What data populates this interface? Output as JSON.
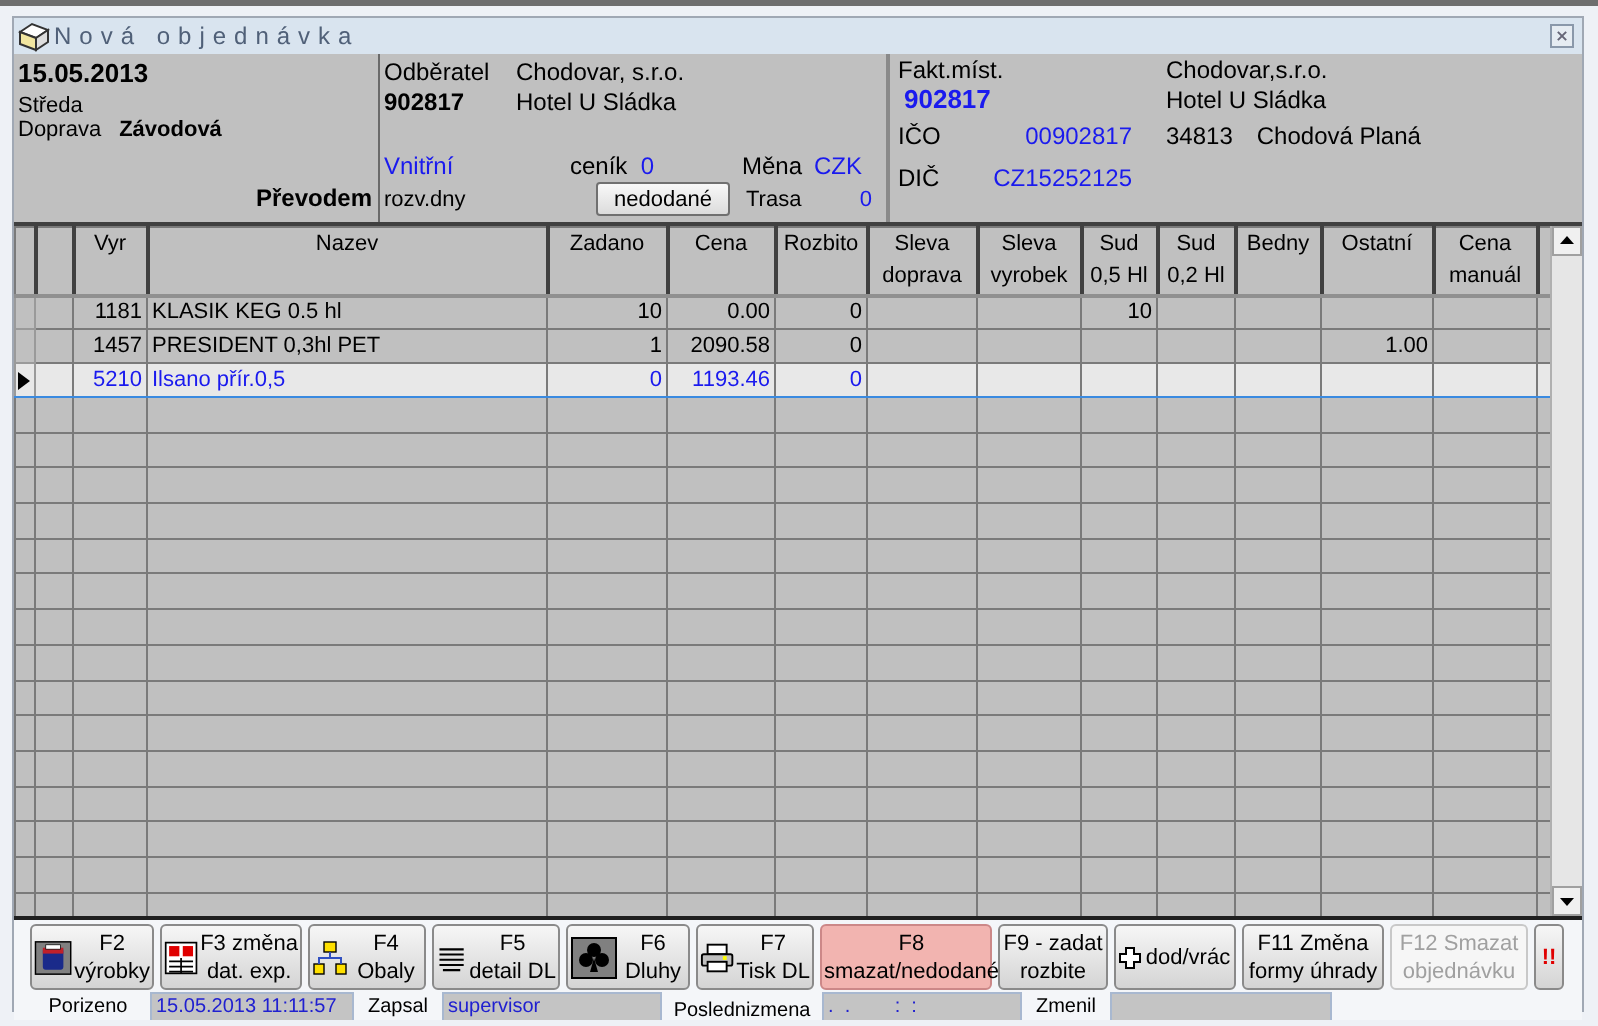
{
  "window": {
    "title": "Nová objednávka"
  },
  "header": {
    "date": "15.05.2013",
    "weekday": "Středa",
    "transport_label": "Doprava",
    "transport": "Závodová",
    "payment": "Převodem",
    "customer_label": "Odběratel",
    "customer_id": "902817",
    "customer_name": "Chodovar, s.r.o.",
    "customer_place": "Hotel U Sládka",
    "zone": "Vnitřní",
    "pricelist_label": "ceník",
    "pricelist": "0",
    "currency_label": "Měna",
    "currency": "CZK",
    "delivery_days_label": "rozv.dny",
    "undelivered_button": "nedodané",
    "route_label": "Trasa",
    "route": "0",
    "billing_label": "Fakt.míst.",
    "billing_id": "902817",
    "billing_name": "Chodovar,s.r.o.",
    "billing_place": "Hotel U Sládka",
    "ico_label": "IČO",
    "ico": "00902817",
    "dic_label": "DIČ",
    "dic": "CZ15252125",
    "zip": "34813",
    "city": "Chodová Planá"
  },
  "table": {
    "columns": [
      "Vyr",
      "Nazev",
      "Zadano",
      "Cena",
      "Rozbito",
      "Sleva doprava",
      "Sleva vyrobek",
      "Sud 0,5 Hl",
      "Sud 0,2 Hl",
      "Bedny",
      "Ostatní",
      "Cena manuál"
    ],
    "rows": [
      {
        "vyr": "1181",
        "nazev": "KLASIK KEG 0.5 hl",
        "zadano": "10",
        "cena": "0.00",
        "rozbito": "0",
        "sud_05": "10",
        "selected": false
      },
      {
        "vyr": "1457",
        "nazev": "PRESIDENT 0,3hl PET",
        "zadano": "1",
        "cena": "2090.58",
        "rozbito": "0",
        "ostatni": "1.00",
        "selected": false
      },
      {
        "vyr": "5210",
        "nazev": "Ilsano přír.0,5",
        "zadano": "0",
        "cena": "1193.46",
        "rozbito": "0",
        "selected": true
      }
    ]
  },
  "buttons": [
    {
      "lines": [
        "F2",
        "výrobky"
      ],
      "highlighted": false,
      "disabled": false
    },
    {
      "lines": [
        "F3 změna",
        "dat. exp."
      ],
      "highlighted": false,
      "disabled": false
    },
    {
      "lines": [
        "F4",
        "Obaly"
      ],
      "highlighted": false,
      "disabled": false
    },
    {
      "lines": [
        "F5",
        "detail DL"
      ],
      "highlighted": false,
      "disabled": false
    },
    {
      "lines": [
        "F6",
        "Dluhy"
      ],
      "highlighted": false,
      "disabled": false
    },
    {
      "lines": [
        "F7",
        "Tisk DL"
      ],
      "highlighted": false,
      "disabled": false
    },
    {
      "lines": [
        "F8",
        "smazat/nedodané"
      ],
      "highlighted": true,
      "disabled": false
    },
    {
      "lines": [
        "F9 - zadat",
        "rozbite"
      ],
      "highlighted": false,
      "disabled": false
    },
    {
      "lines": [
        "dod/vrác"
      ],
      "highlighted": false,
      "disabled": false
    },
    {
      "lines": [
        "F11 Změna",
        "formy úhrady"
      ],
      "highlighted": false,
      "disabled": false
    },
    {
      "lines": [
        "F12  Smazat",
        "objednávku"
      ],
      "highlighted": false,
      "disabled": true
    },
    {
      "lines": [
        "!!"
      ],
      "highlighted": false,
      "disabled": false
    }
  ],
  "status_bar": [
    {
      "label": "Porizeno",
      "value": "15.05.2013 11:11:57"
    },
    {
      "label": "Zapsal",
      "value": "supervisor"
    },
    {
      "label": "Poslednizmena",
      "value": ".  .        :  :"
    },
    {
      "label": "Zmenil"
    }
  ]
}
